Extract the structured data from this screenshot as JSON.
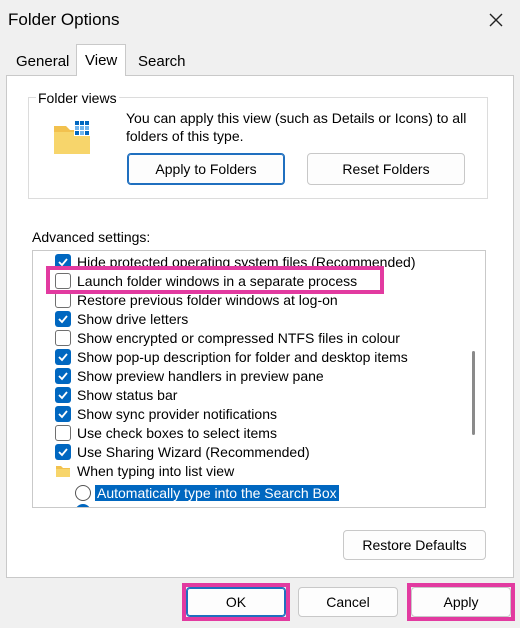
{
  "window": {
    "title": "Folder Options"
  },
  "tabs": [
    {
      "label": "General"
    },
    {
      "label": "View"
    },
    {
      "label": "Search"
    }
  ],
  "folder_views": {
    "group_label": "Folder views",
    "description": "You can apply this view (such as Details or Icons) to all folders of this type.",
    "apply_button": "Apply to Folders",
    "reset_button": "Reset Folders"
  },
  "advanced": {
    "label": "Advanced settings:",
    "items": [
      {
        "label": "Hide protected operating system files (Recommended)",
        "kind": "checkbox",
        "checked": true
      },
      {
        "label": "Launch folder windows in a separate process",
        "kind": "checkbox",
        "checked": false
      },
      {
        "label": "Restore previous folder windows at log-on",
        "kind": "checkbox",
        "checked": false
      },
      {
        "label": "Show drive letters",
        "kind": "checkbox",
        "checked": true
      },
      {
        "label": "Show encrypted or compressed NTFS files in colour",
        "kind": "checkbox",
        "checked": false
      },
      {
        "label": "Show pop-up description for folder and desktop items",
        "kind": "checkbox",
        "checked": true
      },
      {
        "label": "Show preview handlers in preview pane",
        "kind": "checkbox",
        "checked": true
      },
      {
        "label": "Show status bar",
        "kind": "checkbox",
        "checked": true
      },
      {
        "label": "Show sync provider notifications",
        "kind": "checkbox",
        "checked": true
      },
      {
        "label": "Use check boxes to select items",
        "kind": "checkbox",
        "checked": false
      },
      {
        "label": "Use Sharing Wizard (Recommended)",
        "kind": "checkbox",
        "checked": true
      },
      {
        "label": "When typing into list view",
        "kind": "folder"
      },
      {
        "label": "Automatically type into the Search Box",
        "kind": "radio",
        "checked": false,
        "selected": true
      }
    ]
  },
  "restore_defaults": "Restore Defaults",
  "footer": {
    "ok": "OK",
    "cancel": "Cancel",
    "apply": "Apply"
  },
  "colors": {
    "accent": "#0067c0",
    "highlight": "#e23aa0"
  }
}
